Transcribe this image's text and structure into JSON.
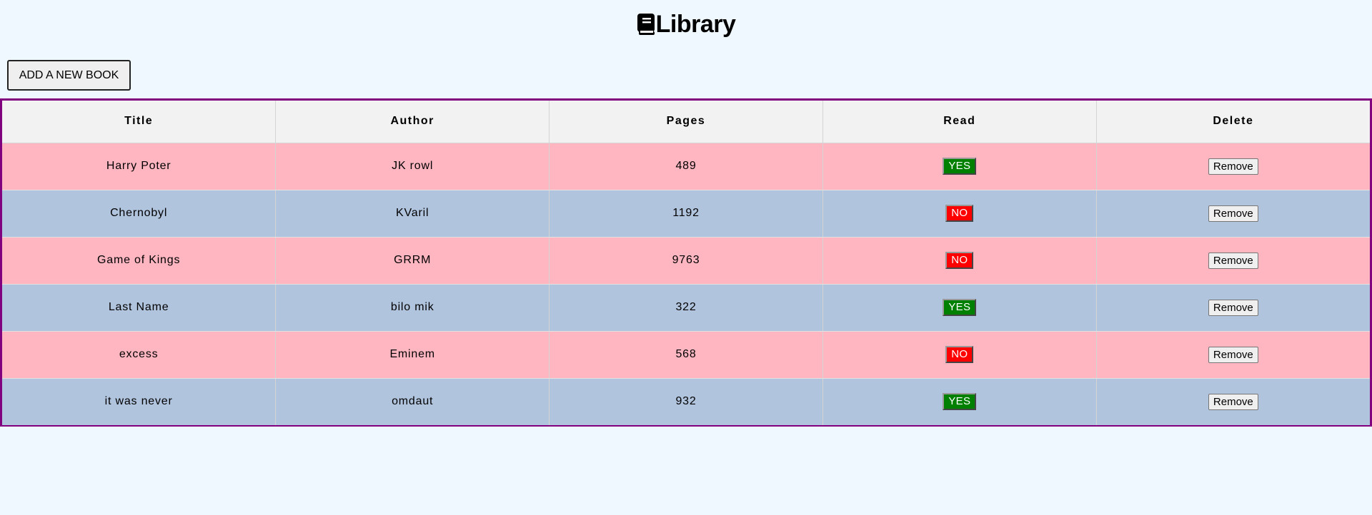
{
  "header": {
    "title": "Library",
    "icon": "book-icon"
  },
  "toolbar": {
    "add_label": "ADD A NEW BOOK"
  },
  "table": {
    "columns": [
      "Title",
      "Author",
      "Pages",
      "Read",
      "Delete"
    ],
    "rows": [
      {
        "title": "Harry Poter",
        "author": "JK rowl",
        "pages": "489",
        "read": "YES",
        "remove": "Remove"
      },
      {
        "title": "Chernobyl",
        "author": "KVaril",
        "pages": "1192",
        "read": "NO",
        "remove": "Remove"
      },
      {
        "title": "Game of Kings",
        "author": "GRRM",
        "pages": "9763",
        "read": "NO",
        "remove": "Remove"
      },
      {
        "title": "Last Name",
        "author": "bilo mik",
        "pages": "322",
        "read": "YES",
        "remove": "Remove"
      },
      {
        "title": "excess",
        "author": "Eminem",
        "pages": "568",
        "read": "NO",
        "remove": "Remove"
      },
      {
        "title": "it was never",
        "author": "omdaut",
        "pages": "932",
        "read": "YES",
        "remove": "Remove"
      }
    ]
  },
  "colors": {
    "background": "#f0f8ff",
    "table_border": "#800080",
    "row_odd": "#ffb6c1",
    "row_even": "#b0c4de",
    "read_yes": "#008000",
    "read_no": "#ff0000"
  }
}
